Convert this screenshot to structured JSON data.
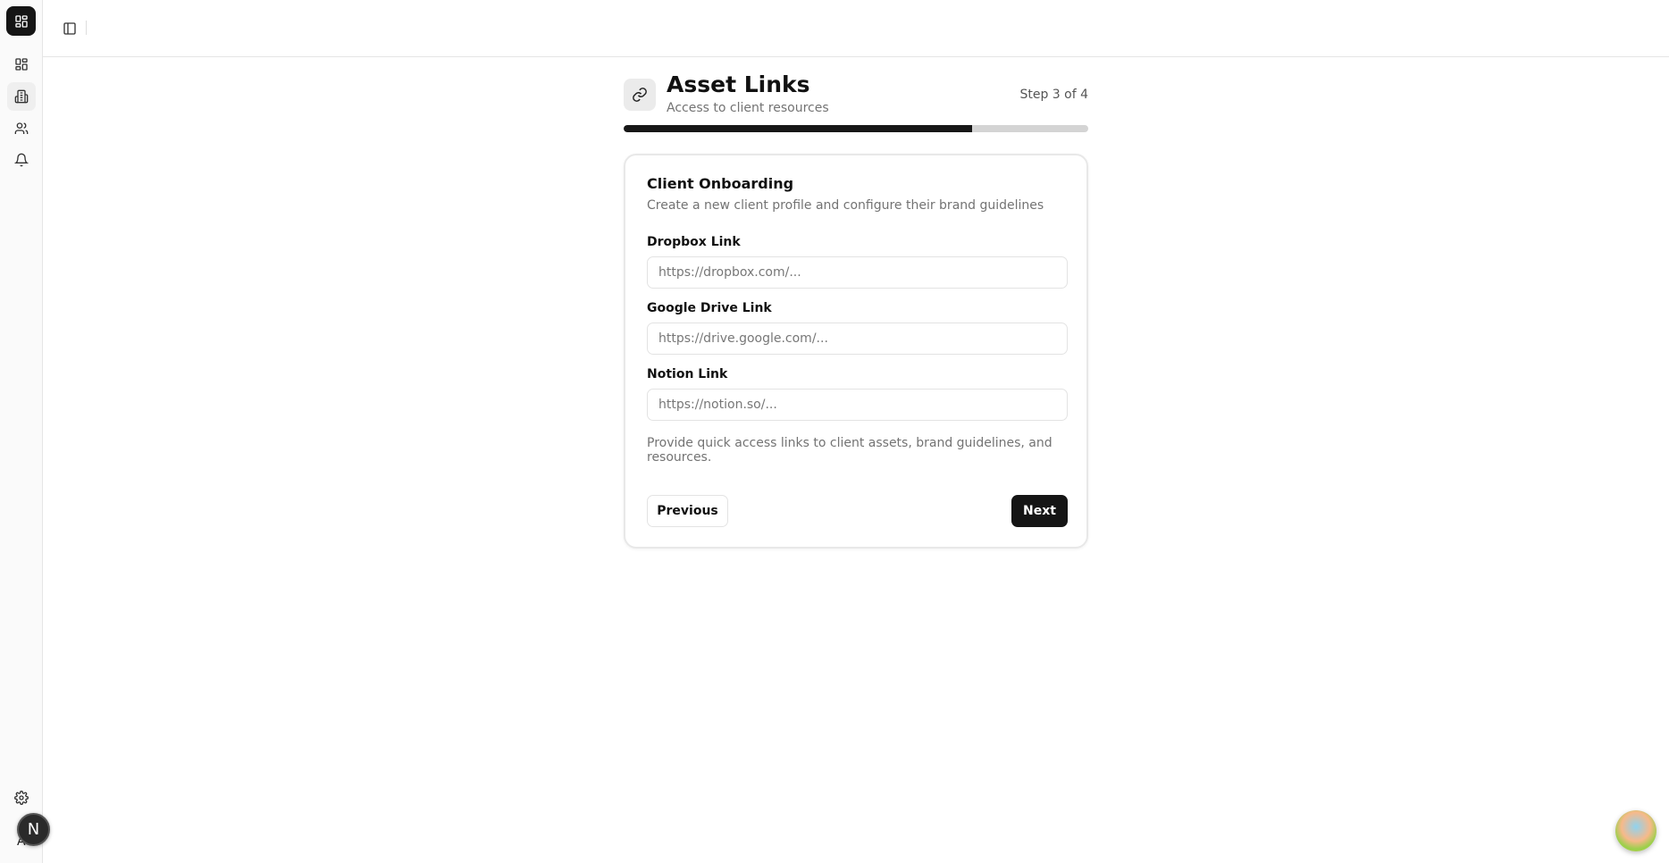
{
  "header": {
    "title": "Asset Links",
    "subtitle": "Access to client resources",
    "step": "Step 3 of 4",
    "progress_fraction": 0.75
  },
  "card": {
    "title": "Client Onboarding",
    "description": "Create a new client profile and configure their brand guidelines",
    "fields": [
      {
        "label": "Dropbox Link",
        "value": "",
        "placeholder": "https://dropbox.com/..."
      },
      {
        "label": "Google Drive Link",
        "value": "",
        "placeholder": "https://drive.google.com/..."
      },
      {
        "label": "Notion Link",
        "value": "",
        "placeholder": "https://notion.so/..."
      }
    ],
    "help": "Provide quick access links to client assets, brand guidelines, and resources.",
    "previous_label": "Previous",
    "next_label": "Next"
  },
  "user": {
    "avatar_initial": "N",
    "label_initial": "A"
  },
  "colors": {
    "primary": "#171717",
    "progress_track": "#d4d4d4",
    "muted_text": "#737373"
  }
}
